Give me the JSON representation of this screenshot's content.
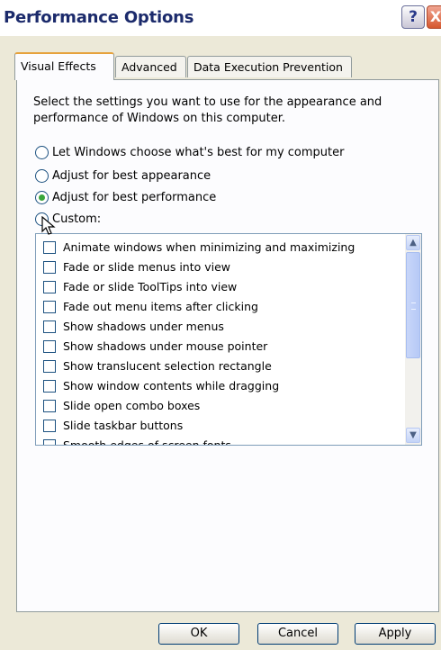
{
  "window": {
    "title": "Performance Options",
    "help_label": "?",
    "close_label": "X"
  },
  "tabs": [
    {
      "label": "Visual Effects",
      "active": true
    },
    {
      "label": "Advanced",
      "active": false
    },
    {
      "label": "Data Execution Prevention",
      "active": false
    }
  ],
  "description": "Select the settings you want to use for the appearance and performance of Windows on this computer.",
  "radio_options": [
    {
      "label": "Let Windows choose what's best for my computer",
      "selected": false
    },
    {
      "label": "Adjust for best appearance",
      "selected": false
    },
    {
      "label": "Adjust for best performance",
      "selected": true
    },
    {
      "label": "Custom:",
      "selected": false
    }
  ],
  "effects": [
    {
      "label": "Animate windows when minimizing and maximizing",
      "checked": false
    },
    {
      "label": "Fade or slide menus into view",
      "checked": false
    },
    {
      "label": "Fade or slide ToolTips into view",
      "checked": false
    },
    {
      "label": "Fade out menu items after clicking",
      "checked": false
    },
    {
      "label": "Show shadows under menus",
      "checked": false
    },
    {
      "label": "Show shadows under mouse pointer",
      "checked": false
    },
    {
      "label": "Show translucent selection rectangle",
      "checked": false
    },
    {
      "label": "Show window contents while dragging",
      "checked": false
    },
    {
      "label": "Slide open combo boxes",
      "checked": false
    },
    {
      "label": "Slide taskbar buttons",
      "checked": false
    },
    {
      "label": "Smooth edges of screen fonts",
      "checked": false
    }
  ],
  "buttons": {
    "ok": "OK",
    "cancel": "Cancel",
    "apply": "Apply"
  },
  "colors": {
    "selected_radio": "#3aa63a",
    "active_tab_accent": "#e6a23c",
    "dialog_background": "#ece9d8"
  }
}
